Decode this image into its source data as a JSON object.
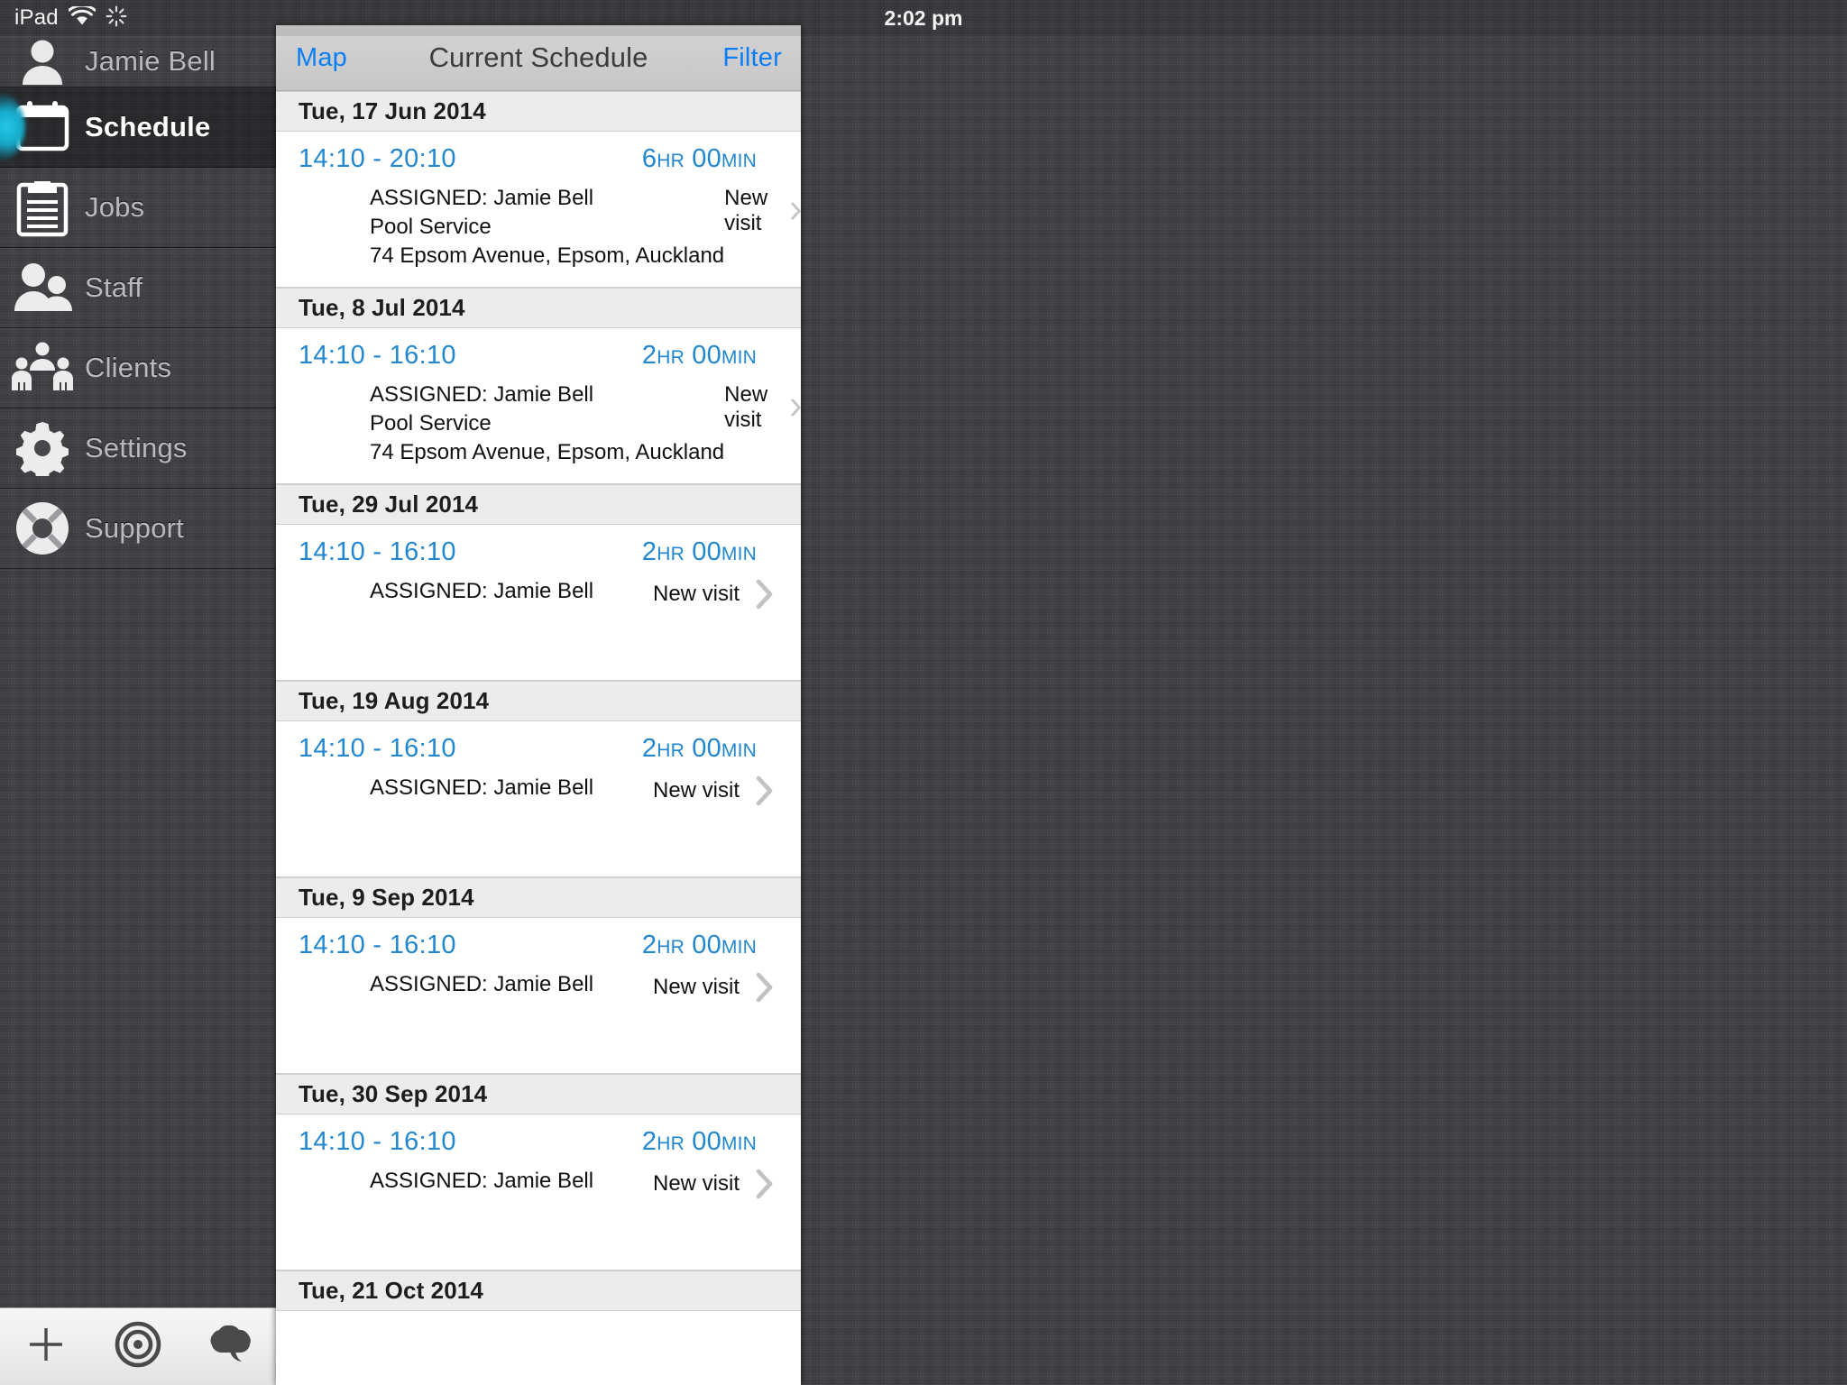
{
  "status_bar": {
    "device_label": "iPad",
    "wifi_icon": "wifi-icon",
    "activity_icon": "activity-spinner-icon",
    "time": "2:02 pm"
  },
  "sidebar": {
    "user": {
      "name": "Jamie Bell",
      "icon": "person-icon"
    },
    "items": [
      {
        "label": "Schedule",
        "icon": "calendar-icon",
        "active": true
      },
      {
        "label": "Jobs",
        "icon": "clipboard-icon",
        "active": false
      },
      {
        "label": "Staff",
        "icon": "two-people-icon",
        "active": false
      },
      {
        "label": "Clients",
        "icon": "people-group-icon",
        "active": false
      },
      {
        "label": "Settings",
        "icon": "gear-icon",
        "active": false
      },
      {
        "label": "Support",
        "icon": "lifebuoy-icon",
        "active": false
      }
    ],
    "accent_color": "#19b4d6"
  },
  "bottom_toolbar": {
    "buttons": [
      {
        "name": "add-button",
        "icon": "plus-icon"
      },
      {
        "name": "target-button",
        "icon": "target-icon"
      },
      {
        "name": "chat-button",
        "icon": "speech-cloud-icon"
      }
    ]
  },
  "panel": {
    "nav": {
      "left_button": "Map",
      "title": "Current Schedule",
      "right_button": "Filter",
      "link_color": "#0b7ef5"
    },
    "accent_color": "#2287d0",
    "sections": [
      {
        "date": "Tue, 17 Jun 2014",
        "entries": [
          {
            "time": "14:10 - 20:10",
            "duration_value": "6",
            "duration_unit_1": "HR",
            "duration_minutes": "00",
            "duration_unit_2": "MIN",
            "lines": [
              "ASSIGNED: Jamie Bell",
              "Pool Service",
              "74 Epsom Avenue, Epsom, Auckland"
            ],
            "status": "New visit"
          }
        ]
      },
      {
        "date": "Tue, 8 Jul 2014",
        "entries": [
          {
            "time": "14:10 - 16:10",
            "duration_value": "2",
            "duration_unit_1": "HR",
            "duration_minutes": "00",
            "duration_unit_2": "MIN",
            "lines": [
              "ASSIGNED: Jamie Bell",
              "Pool Service",
              "74 Epsom Avenue, Epsom, Auckland"
            ],
            "status": "New visit"
          }
        ]
      },
      {
        "date": "Tue, 29 Jul 2014",
        "entries": [
          {
            "time": "14:10 - 16:10",
            "duration_value": "2",
            "duration_unit_1": "HR",
            "duration_minutes": "00",
            "duration_unit_2": "MIN",
            "lines": [
              "ASSIGNED: Jamie Bell"
            ],
            "status": "New visit"
          }
        ]
      },
      {
        "date": "Tue, 19 Aug 2014",
        "entries": [
          {
            "time": "14:10 - 16:10",
            "duration_value": "2",
            "duration_unit_1": "HR",
            "duration_minutes": "00",
            "duration_unit_2": "MIN",
            "lines": [
              "ASSIGNED: Jamie Bell"
            ],
            "status": "New visit"
          }
        ]
      },
      {
        "date": "Tue, 9 Sep 2014",
        "entries": [
          {
            "time": "14:10 - 16:10",
            "duration_value": "2",
            "duration_unit_1": "HR",
            "duration_minutes": "00",
            "duration_unit_2": "MIN",
            "lines": [
              "ASSIGNED: Jamie Bell"
            ],
            "status": "New visit"
          }
        ]
      },
      {
        "date": "Tue, 30 Sep 2014",
        "entries": [
          {
            "time": "14:10 - 16:10",
            "duration_value": "2",
            "duration_unit_1": "HR",
            "duration_minutes": "00",
            "duration_unit_2": "MIN",
            "lines": [
              "ASSIGNED: Jamie Bell"
            ],
            "status": "New visit"
          }
        ]
      },
      {
        "date": "Tue, 21 Oct 2014",
        "entries": []
      }
    ]
  }
}
